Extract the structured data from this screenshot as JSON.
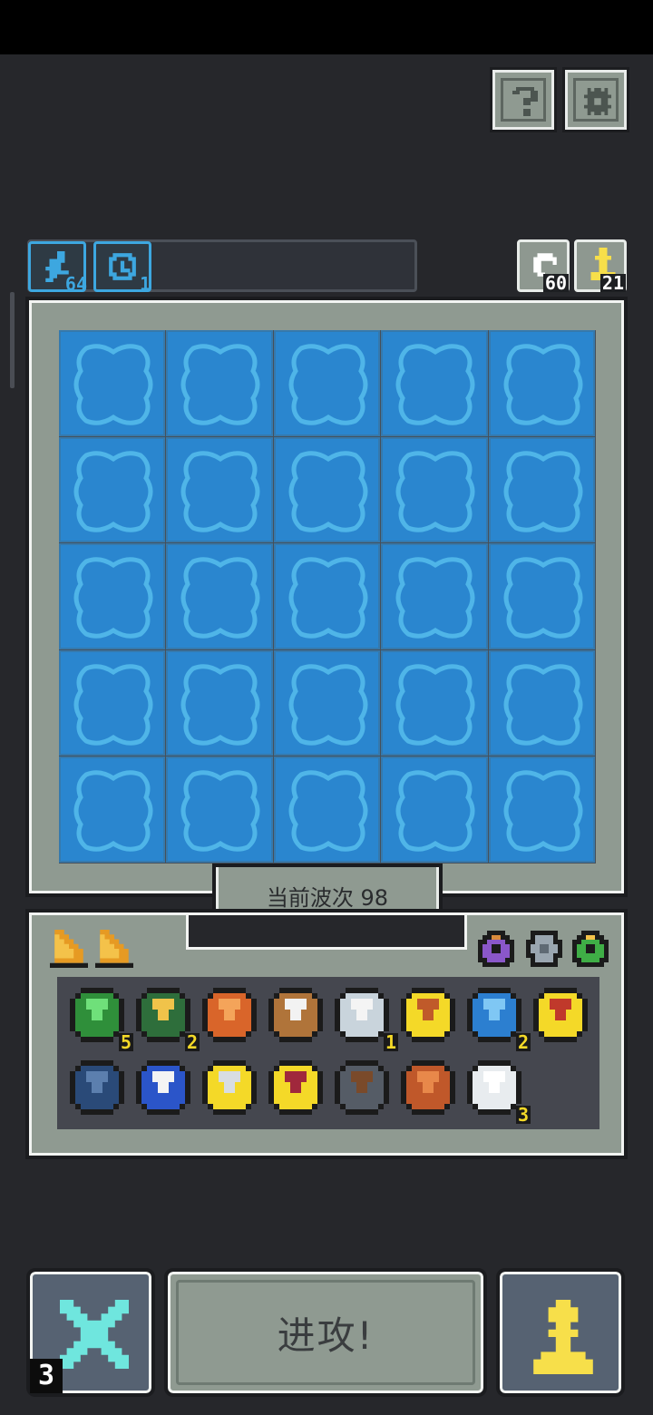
{
  "header": {
    "help_icon": "question-icon",
    "settings_icon": "gear-icon"
  },
  "top_bar": {
    "speed_count": "64",
    "clock_count": "1",
    "reroll_count": "60",
    "pawn_count": "21"
  },
  "board": {
    "rows": 5,
    "cols": 5,
    "tile_color": "#2a86cf",
    "wave_label": "当前波次 98"
  },
  "inventory": {
    "cards": [
      "orange-triangle-card",
      "orange-triangle-card"
    ],
    "relics": [
      "purple-ring-icon",
      "grey-armor-icon",
      "green-ring-icon"
    ],
    "items": [
      {
        "icon": "green-gem-shield",
        "count": "5"
      },
      {
        "icon": "hooded-figure",
        "count": "2"
      },
      {
        "icon": "orange-shield",
        "count": ""
      },
      {
        "icon": "sailing-ship",
        "count": ""
      },
      {
        "icon": "anvil",
        "count": "1"
      },
      {
        "icon": "treasure-map",
        "count": ""
      },
      {
        "icon": "blue-whale",
        "count": "2"
      },
      {
        "icon": "red-chest",
        "count": ""
      },
      {
        "icon": "blue-cannon",
        "count": ""
      },
      {
        "icon": "cauldron",
        "count": ""
      },
      {
        "icon": "battle-axe",
        "count": ""
      },
      {
        "icon": "red-boot",
        "count": ""
      },
      {
        "icon": "hammer",
        "count": ""
      },
      {
        "icon": "wooden-stick",
        "count": ""
      },
      {
        "icon": "white-cloud",
        "count": "3"
      }
    ]
  },
  "bottom": {
    "cancel_count": "3",
    "attack_label": "进攻!",
    "cancel_icon": "cross-icon",
    "pawn_icon": "pawn-icon"
  }
}
